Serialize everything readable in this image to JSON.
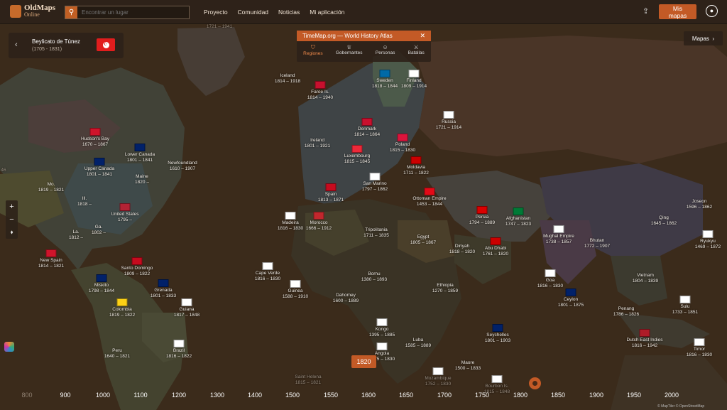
{
  "app": {
    "logo_line1": "OldMaps",
    "logo_line2": "Online"
  },
  "search": {
    "placeholder": "Encontrar un lugar"
  },
  "nav": [
    "Proyecto",
    "Comunidad",
    "Noticias",
    "Mi aplicación"
  ],
  "header": {
    "mis_mapas": "Mis mapas"
  },
  "state_card": {
    "name": "Beylicato de Túnez",
    "years": "(1705 - 1831)"
  },
  "atlas_panel": {
    "title": "TimeMap.org — World History Atlas",
    "tabs": [
      "Regiones",
      "Gobernantes",
      "Personas",
      "Batallas"
    ]
  },
  "mapas_button": "Mapas",
  "current_year": "1820",
  "timeline_ticks": [
    "800",
    "900",
    "1000",
    "1100",
    "1200",
    "1300",
    "1400",
    "1500",
    "1550",
    "1600",
    "1650",
    "1700",
    "1750",
    "1800",
    "1850",
    "1900",
    "1950",
    "2000"
  ],
  "attribution": "© MapTiler © OpenStreetMap",
  "regions": [
    {
      "name": "Iceland",
      "years": "1814 – 1918"
    },
    {
      "name": "Faroe Is.",
      "years": "1814 – 1940"
    },
    {
      "name": "Sweden",
      "years": "1818 – 1844"
    },
    {
      "name": "Finland",
      "years": "1809 – 1914"
    },
    {
      "name": "Russia",
      "years": "1721 – 1914"
    },
    {
      "name": "Denmark",
      "years": "1814 – 1864"
    },
    {
      "name": "Poland",
      "years": "1815 – 1830"
    },
    {
      "name": "Ireland",
      "years": "1801 – 1921"
    },
    {
      "name": "Luxembourg",
      "years": "1815 – 1845"
    },
    {
      "name": "Moldavia",
      "years": "1711 – 1822"
    },
    {
      "name": "San Marino",
      "years": "1797 – 1862"
    },
    {
      "name": "Spain",
      "years": "1813 – 1871"
    },
    {
      "name": "Ottoman Empire",
      "years": "1453 – 1844"
    },
    {
      "name": "Hudson's Bay",
      "years": "1670 – 1867"
    },
    {
      "name": "Lower Canada",
      "years": "1801 – 1841"
    },
    {
      "name": "Upper Canada",
      "years": "1801 – 1841"
    },
    {
      "name": "Newfoundland",
      "years": "1610 – 1907"
    },
    {
      "name": "Maine",
      "years": "1820 –"
    },
    {
      "name": "Mo.",
      "years": "1819 – 1821"
    },
    {
      "name": "Ill.",
      "years": "1818 –"
    },
    {
      "name": "United States",
      "years": "1795 –"
    },
    {
      "name": "Ga.",
      "years": "1802 –"
    },
    {
      "name": "La.",
      "years": "1812 –"
    },
    {
      "name": "Madeira",
      "years": "1816 – 1830"
    },
    {
      "name": "Morocco",
      "years": "1666 – 1912"
    },
    {
      "name": "Tripolitania",
      "years": "1711 – 1835"
    },
    {
      "name": "Egypt",
      "years": "1805 – 1867"
    },
    {
      "name": "Persia",
      "years": "1794 – 1889"
    },
    {
      "name": "Afghanistan",
      "years": "1747 – 1823"
    },
    {
      "name": "Qing",
      "years": "1645 – 1862"
    },
    {
      "name": "Joseon",
      "years": "1596 – 1862"
    },
    {
      "name": "Ryukyu",
      "years": "1469 – 1872"
    },
    {
      "name": "Mughal Empire",
      "years": "1738 – 1857"
    },
    {
      "name": "Bhutan",
      "years": "1772 – 1907"
    },
    {
      "name": "Diriyah",
      "years": "1818 – 1820"
    },
    {
      "name": "Abu Dhabi",
      "years": "1761 – 1820"
    },
    {
      "name": "New Spain",
      "years": "1814 – 1821"
    },
    {
      "name": "Santo Domingo",
      "years": "1809 – 1822"
    },
    {
      "name": "Miskito",
      "years": "1798 – 1844"
    },
    {
      "name": "Grenada",
      "years": "1801 – 1833"
    },
    {
      "name": "Cape Verde",
      "years": "1816 – 1830"
    },
    {
      "name": "Guinea",
      "years": "1588 – 1910"
    },
    {
      "name": "Bornu",
      "years": "1380 – 1893"
    },
    {
      "name": "Dahomey",
      "years": "1600 – 1889"
    },
    {
      "name": "Ethiopia",
      "years": "1270 – 1859"
    },
    {
      "name": "Goa",
      "years": "1816 – 1830"
    },
    {
      "name": "Ceylon",
      "years": "1801 – 1875"
    },
    {
      "name": "Vietnam",
      "years": "1804 – 1839"
    },
    {
      "name": "Penang",
      "years": "1786 – 1826"
    },
    {
      "name": "Sulu",
      "years": "1733 – 1851"
    },
    {
      "name": "Colombia",
      "years": "1819 – 1822"
    },
    {
      "name": "Guiana",
      "years": "1817 – 1848"
    },
    {
      "name": "Kongo",
      "years": "1395 – 1885"
    },
    {
      "name": "Luba",
      "years": "1585 – 1889"
    },
    {
      "name": "Seychelles",
      "years": "1801 – 1903"
    },
    {
      "name": "Dutch East Indies",
      "years": "1816 – 1942"
    },
    {
      "name": "Timor",
      "years": "1816 – 1830"
    },
    {
      "name": "Peru",
      "years": "1640 – 1821"
    },
    {
      "name": "Brazil",
      "years": "1816 – 1822"
    },
    {
      "name": "Angola",
      "years": "1575 – 1830"
    },
    {
      "name": "Maore",
      "years": "1500 – 1833"
    },
    {
      "name": "Saint Helena",
      "years": "1815 – 1821"
    },
    {
      "name": "Mozambique",
      "years": "1752 – 1830"
    },
    {
      "name": "Bourbon Is.",
      "years": "1815 – 1848"
    }
  ],
  "top_label": "1721 – 1941",
  "left_label": "46"
}
